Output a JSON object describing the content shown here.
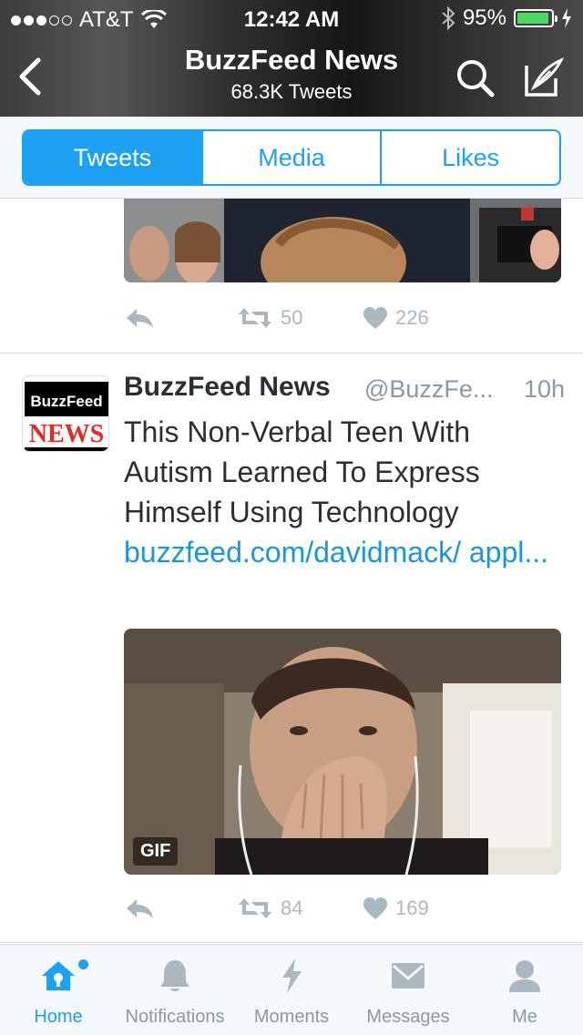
{
  "status_bar": {
    "carrier": "AT&T",
    "time": "12:42 AM",
    "battery": "95%",
    "battery_level": 0.95,
    "signal_dots_filled": 3,
    "signal_dots_total": 5
  },
  "nav": {
    "title": "BuzzFeed News",
    "subtitle": "68.3K Tweets",
    "icons": [
      "back-icon",
      "search-icon",
      "compose-icon"
    ]
  },
  "segments": [
    {
      "label": "Tweets",
      "active": true
    },
    {
      "label": "Media",
      "active": false
    },
    {
      "label": "Likes",
      "active": false
    }
  ],
  "timeline": {
    "previous_tweet": {
      "retweets": "50",
      "likes": "226"
    },
    "tweet": {
      "avatar_text_top": "BuzzFeed",
      "avatar_text_bottom": "NEWS",
      "name": "BuzzFeed News",
      "handle": "@BuzzFe...",
      "time": "10h",
      "text": "This Non-Verbal Teen With Autism Learned To Express Himself Using Technology",
      "link": "buzzfeed.com/davidmack/ appl...",
      "media_badge": "GIF",
      "retweets": "84",
      "likes": "169"
    }
  },
  "tabbar": {
    "items": [
      {
        "label": "Home",
        "icon": "home-icon",
        "active": true
      },
      {
        "label": "Notifications",
        "icon": "bell-icon",
        "active": false
      },
      {
        "label": "Moments",
        "icon": "lightning-icon",
        "active": false
      },
      {
        "label": "Messages",
        "icon": "envelope-icon",
        "active": false
      },
      {
        "label": "Me",
        "icon": "person-icon",
        "active": false
      }
    ]
  },
  "colors": {
    "accent": "#1da1f2",
    "link": "#1b95e0",
    "muted": "#8899a6",
    "text": "#292f33",
    "battery": "#4cd964"
  }
}
